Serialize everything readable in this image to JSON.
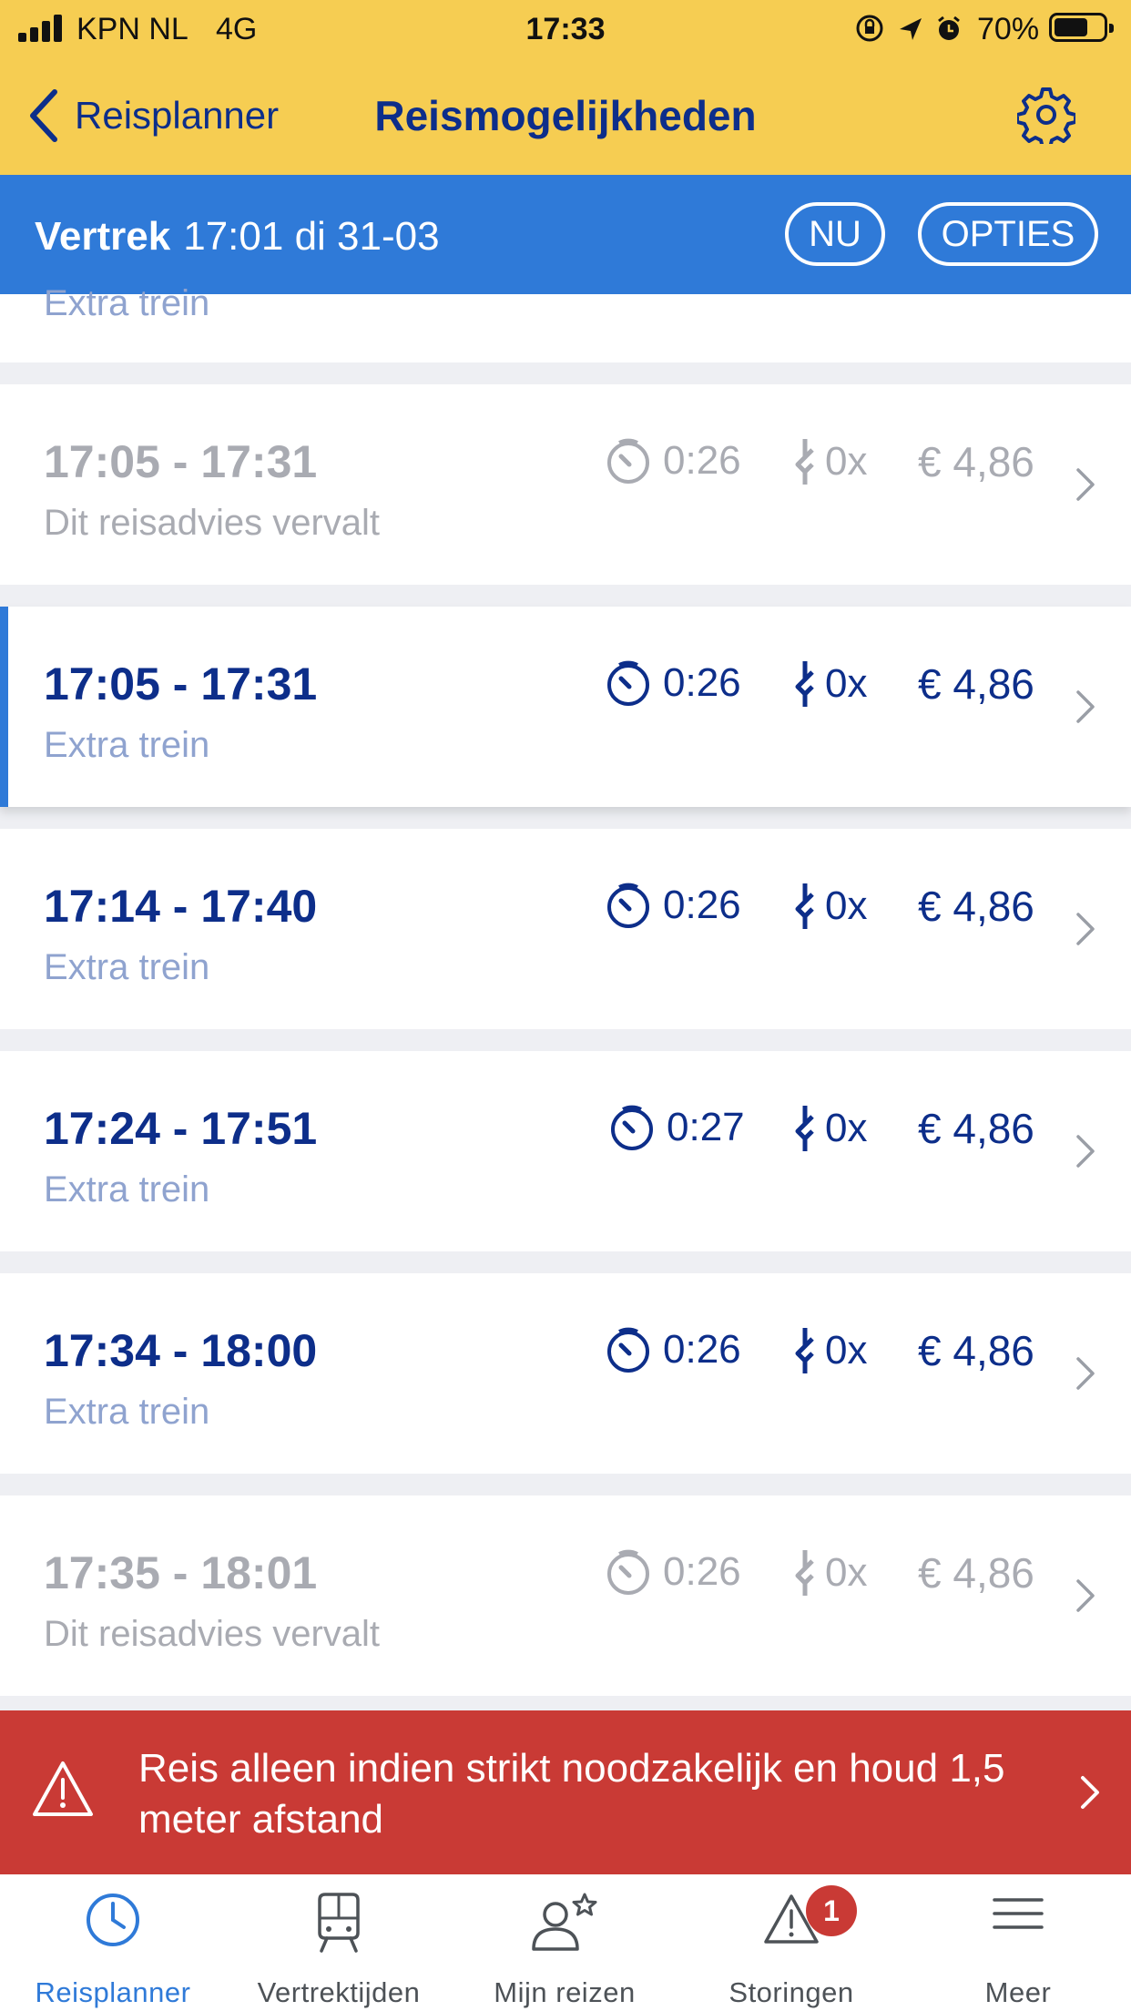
{
  "status_bar": {
    "carrier": "KPN NL",
    "network": "4G",
    "time": "17:33",
    "battery_percent": "70%",
    "battery_level": 0.7
  },
  "nav": {
    "back_label": "Reisplanner",
    "title": "Reismogelijkheden"
  },
  "filter": {
    "departure_label": "Vertrek",
    "departure_value": "17:01 di 31-03",
    "now_label": "NU",
    "options_label": "OPTIES"
  },
  "partial_row": {
    "subtitle": "Extra trein"
  },
  "trips": [
    {
      "times": "17:05 - 17:31",
      "subtitle": "Dit reisadvies vervalt",
      "duration": "0:26",
      "transfers": "0x",
      "price": "€ 4,86",
      "state": "expired"
    },
    {
      "times": "17:05 - 17:31",
      "subtitle": "Extra trein",
      "duration": "0:26",
      "transfers": "0x",
      "price": "€ 4,86",
      "state": "selected"
    },
    {
      "times": "17:14 - 17:40",
      "subtitle": "Extra trein",
      "duration": "0:26",
      "transfers": "0x",
      "price": "€ 4,86",
      "state": "normal"
    },
    {
      "times": "17:24 - 17:51",
      "subtitle": "Extra trein",
      "duration": "0:27",
      "transfers": "0x",
      "price": "€ 4,86",
      "state": "normal"
    },
    {
      "times": "17:34 - 18:00",
      "subtitle": "Extra trein",
      "duration": "0:26",
      "transfers": "0x",
      "price": "€ 4,86",
      "state": "normal"
    },
    {
      "times": "17:35 - 18:01",
      "subtitle": "Dit reisadvies vervalt",
      "duration": "0:26",
      "transfers": "0x",
      "price": "€ 4,86",
      "state": "expired"
    }
  ],
  "alert": {
    "message": "Reis alleen indien strikt noodzakelijk en houd 1,5 meter afstand",
    "icon": "warning-icon"
  },
  "tabs": [
    {
      "label": "Reisplanner",
      "icon": "clock-icon",
      "active": true
    },
    {
      "label": "Vertrektijden",
      "icon": "train-icon",
      "active": false
    },
    {
      "label": "Mijn reizen",
      "icon": "person-star-icon",
      "active": false
    },
    {
      "label": "Storingen",
      "icon": "warning-icon",
      "active": false,
      "badge": "1"
    },
    {
      "label": "Meer",
      "icon": "menu-icon",
      "active": false
    }
  ],
  "colors": {
    "header_yellow": "#f6cd52",
    "nav_blue": "#0d2e8a",
    "accent_blue": "#2f7ad8",
    "alert_red": "#c93a35",
    "muted_text": "#8fa3cf",
    "expired_text": "#a9abb2"
  }
}
